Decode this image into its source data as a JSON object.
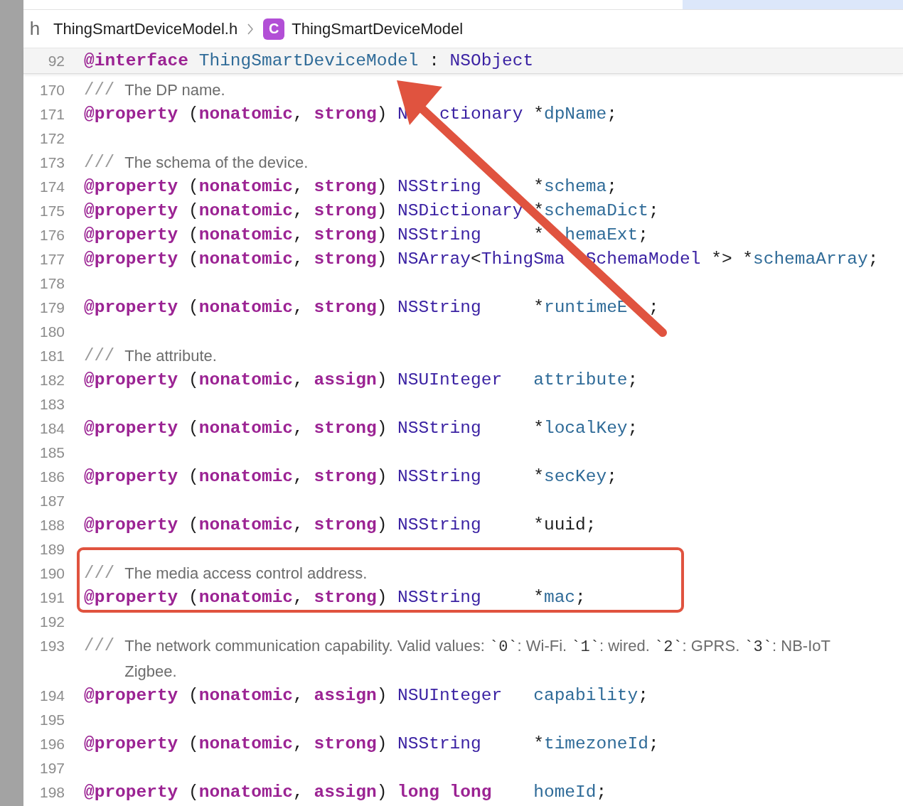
{
  "breadcrumb": {
    "file_icon": "h",
    "file": "ThingSmartDeviceModel.h",
    "class_badge": "C",
    "symbol": "ThingSmartDeviceModel"
  },
  "sticky_header": {
    "number": "92",
    "tokens": [
      {
        "kind": "keyword",
        "text": "@interface "
      },
      {
        "kind": "ident",
        "text": "ThingSmartDeviceModel"
      },
      {
        "kind": "plain",
        "text": " : "
      },
      {
        "kind": "type",
        "text": "NSObject"
      }
    ]
  },
  "lines": [
    {
      "number": "170",
      "kind": "comment",
      "marker": "///",
      "segments": [
        {
          "kind": "text",
          "text": "The DP name."
        }
      ]
    },
    {
      "number": "171",
      "kind": "code",
      "tokens": [
        {
          "kind": "keyword",
          "text": "@property"
        },
        {
          "kind": "plain",
          "text": " ("
        },
        {
          "kind": "keyword",
          "text": "nonatomic"
        },
        {
          "kind": "plain",
          "text": ", "
        },
        {
          "kind": "keyword",
          "text": "strong"
        },
        {
          "kind": "plain",
          "text": ") "
        },
        {
          "kind": "type",
          "text": "N   ctionary"
        },
        {
          "kind": "plain",
          "text": " *"
        },
        {
          "kind": "ident",
          "text": "dpName"
        },
        {
          "kind": "plain",
          "text": ";"
        }
      ]
    },
    {
      "number": "172",
      "kind": "blank"
    },
    {
      "number": "173",
      "kind": "comment",
      "marker": "///",
      "segments": [
        {
          "kind": "text",
          "text": "The schema of the device."
        }
      ]
    },
    {
      "number": "174",
      "kind": "code",
      "tokens": [
        {
          "kind": "keyword",
          "text": "@property"
        },
        {
          "kind": "plain",
          "text": " ("
        },
        {
          "kind": "keyword",
          "text": "nonatomic"
        },
        {
          "kind": "plain",
          "text": ", "
        },
        {
          "kind": "keyword",
          "text": "strong"
        },
        {
          "kind": "plain",
          "text": ") "
        },
        {
          "kind": "type",
          "text": "NSString"
        },
        {
          "kind": "plain",
          "text": "     *"
        },
        {
          "kind": "ident",
          "text": "schema"
        },
        {
          "kind": "plain",
          "text": ";"
        }
      ]
    },
    {
      "number": "175",
      "kind": "code",
      "tokens": [
        {
          "kind": "keyword",
          "text": "@property"
        },
        {
          "kind": "plain",
          "text": " ("
        },
        {
          "kind": "keyword",
          "text": "nonatomic"
        },
        {
          "kind": "plain",
          "text": ", "
        },
        {
          "kind": "keyword",
          "text": "strong"
        },
        {
          "kind": "plain",
          "text": ") "
        },
        {
          "kind": "type",
          "text": "NSDictionary"
        },
        {
          "kind": "plain",
          "text": " *"
        },
        {
          "kind": "ident",
          "text": "schemaDict"
        },
        {
          "kind": "plain",
          "text": ";"
        }
      ]
    },
    {
      "number": "176",
      "kind": "code",
      "tokens": [
        {
          "kind": "keyword",
          "text": "@property"
        },
        {
          "kind": "plain",
          "text": " ("
        },
        {
          "kind": "keyword",
          "text": "nonatomic"
        },
        {
          "kind": "plain",
          "text": ", "
        },
        {
          "kind": "keyword",
          "text": "strong"
        },
        {
          "kind": "plain",
          "text": ") "
        },
        {
          "kind": "type",
          "text": "NSString"
        },
        {
          "kind": "plain",
          "text": "     *"
        },
        {
          "kind": "ident",
          "text": "  hemaExt"
        },
        {
          "kind": "plain",
          "text": ";"
        }
      ]
    },
    {
      "number": "177",
      "kind": "code",
      "tokens": [
        {
          "kind": "keyword",
          "text": "@property"
        },
        {
          "kind": "plain",
          "text": " ("
        },
        {
          "kind": "keyword",
          "text": "nonatomic"
        },
        {
          "kind": "plain",
          "text": ", "
        },
        {
          "kind": "keyword",
          "text": "strong"
        },
        {
          "kind": "plain",
          "text": ") "
        },
        {
          "kind": "type",
          "text": "NSArray"
        },
        {
          "kind": "plain",
          "text": "<"
        },
        {
          "kind": "type",
          "text": "ThingSma  SchemaModel"
        },
        {
          "kind": "plain",
          "text": " *> *"
        },
        {
          "kind": "ident",
          "text": "schemaArray"
        },
        {
          "kind": "plain",
          "text": ";"
        }
      ]
    },
    {
      "number": "178",
      "kind": "blank"
    },
    {
      "number": "179",
      "kind": "code",
      "tokens": [
        {
          "kind": "keyword",
          "text": "@property"
        },
        {
          "kind": "plain",
          "text": " ("
        },
        {
          "kind": "keyword",
          "text": "nonatomic"
        },
        {
          "kind": "plain",
          "text": ", "
        },
        {
          "kind": "keyword",
          "text": "strong"
        },
        {
          "kind": "plain",
          "text": ") "
        },
        {
          "kind": "type",
          "text": "NSString"
        },
        {
          "kind": "plain",
          "text": "     *"
        },
        {
          "kind": "ident",
          "text": "runtimeE  "
        },
        {
          "kind": "plain",
          "text": ";"
        }
      ]
    },
    {
      "number": "180",
      "kind": "blank"
    },
    {
      "number": "181",
      "kind": "comment",
      "marker": "///",
      "segments": [
        {
          "kind": "text",
          "text": "The attribute."
        }
      ]
    },
    {
      "number": "182",
      "kind": "code",
      "tokens": [
        {
          "kind": "keyword",
          "text": "@property"
        },
        {
          "kind": "plain",
          "text": " ("
        },
        {
          "kind": "keyword",
          "text": "nonatomic"
        },
        {
          "kind": "plain",
          "text": ", "
        },
        {
          "kind": "keyword",
          "text": "assign"
        },
        {
          "kind": "plain",
          "text": ") "
        },
        {
          "kind": "type",
          "text": "NSUInteger   "
        },
        {
          "kind": "ident",
          "text": "attribute"
        },
        {
          "kind": "plain",
          "text": ";"
        }
      ]
    },
    {
      "number": "183",
      "kind": "blank"
    },
    {
      "number": "184",
      "kind": "code",
      "tokens": [
        {
          "kind": "keyword",
          "text": "@property"
        },
        {
          "kind": "plain",
          "text": " ("
        },
        {
          "kind": "keyword",
          "text": "nonatomic"
        },
        {
          "kind": "plain",
          "text": ", "
        },
        {
          "kind": "keyword",
          "text": "strong"
        },
        {
          "kind": "plain",
          "text": ") "
        },
        {
          "kind": "type",
          "text": "NSString"
        },
        {
          "kind": "plain",
          "text": "     *"
        },
        {
          "kind": "ident",
          "text": "localKey"
        },
        {
          "kind": "plain",
          "text": ";"
        }
      ]
    },
    {
      "number": "185",
      "kind": "blank"
    },
    {
      "number": "186",
      "kind": "code",
      "tokens": [
        {
          "kind": "keyword",
          "text": "@property"
        },
        {
          "kind": "plain",
          "text": " ("
        },
        {
          "kind": "keyword",
          "text": "nonatomic"
        },
        {
          "kind": "plain",
          "text": ", "
        },
        {
          "kind": "keyword",
          "text": "strong"
        },
        {
          "kind": "plain",
          "text": ") "
        },
        {
          "kind": "type",
          "text": "NSString"
        },
        {
          "kind": "plain",
          "text": "     *"
        },
        {
          "kind": "ident",
          "text": "secKey"
        },
        {
          "kind": "plain",
          "text": ";"
        }
      ]
    },
    {
      "number": "187",
      "kind": "blank"
    },
    {
      "number": "188",
      "kind": "code",
      "tokens": [
        {
          "kind": "keyword",
          "text": "@property"
        },
        {
          "kind": "plain",
          "text": " ("
        },
        {
          "kind": "keyword",
          "text": "nonatomic"
        },
        {
          "kind": "plain",
          "text": ", "
        },
        {
          "kind": "keyword",
          "text": "strong"
        },
        {
          "kind": "plain",
          "text": ") "
        },
        {
          "kind": "type",
          "text": "NSString"
        },
        {
          "kind": "plain",
          "text": "     *uuid;"
        }
      ]
    },
    {
      "number": "189",
      "kind": "blank"
    },
    {
      "number": "190",
      "kind": "comment",
      "marker": "///",
      "segments": [
        {
          "kind": "text",
          "text": "The media access control address."
        }
      ]
    },
    {
      "number": "191",
      "kind": "code",
      "tokens": [
        {
          "kind": "keyword",
          "text": "@property"
        },
        {
          "kind": "plain",
          "text": " ("
        },
        {
          "kind": "keyword",
          "text": "nonatomic"
        },
        {
          "kind": "plain",
          "text": ", "
        },
        {
          "kind": "keyword",
          "text": "strong"
        },
        {
          "kind": "plain",
          "text": ") "
        },
        {
          "kind": "type",
          "text": "NSString"
        },
        {
          "kind": "plain",
          "text": "     *"
        },
        {
          "kind": "ident",
          "text": "mac"
        },
        {
          "kind": "plain",
          "text": ";"
        }
      ]
    },
    {
      "number": "192",
      "kind": "blank"
    },
    {
      "number": "193",
      "kind": "comment",
      "marker": "///",
      "segments": [
        {
          "kind": "text",
          "text": "The network communication capability. Valid values: "
        },
        {
          "kind": "code",
          "text": "`0`"
        },
        {
          "kind": "text",
          "text": ": Wi-Fi. "
        },
        {
          "kind": "code",
          "text": "`1`"
        },
        {
          "kind": "text",
          "text": ": wired. "
        },
        {
          "kind": "code",
          "text": "`2`"
        },
        {
          "kind": "text",
          "text": ": GPRS. "
        },
        {
          "kind": "code",
          "text": "`3`"
        },
        {
          "kind": "text",
          "text": ": NB-IoT"
        }
      ],
      "continuation": "Zigbee."
    },
    {
      "number": "194",
      "kind": "code",
      "tokens": [
        {
          "kind": "keyword",
          "text": "@property"
        },
        {
          "kind": "plain",
          "text": " ("
        },
        {
          "kind": "keyword",
          "text": "nonatomic"
        },
        {
          "kind": "plain",
          "text": ", "
        },
        {
          "kind": "keyword",
          "text": "assign"
        },
        {
          "kind": "plain",
          "text": ") "
        },
        {
          "kind": "type",
          "text": "NSUInteger   "
        },
        {
          "kind": "ident",
          "text": "capability"
        },
        {
          "kind": "plain",
          "text": ";"
        }
      ]
    },
    {
      "number": "195",
      "kind": "blank"
    },
    {
      "number": "196",
      "kind": "code",
      "tokens": [
        {
          "kind": "keyword",
          "text": "@property"
        },
        {
          "kind": "plain",
          "text": " ("
        },
        {
          "kind": "keyword",
          "text": "nonatomic"
        },
        {
          "kind": "plain",
          "text": ", "
        },
        {
          "kind": "keyword",
          "text": "strong"
        },
        {
          "kind": "plain",
          "text": ") "
        },
        {
          "kind": "type",
          "text": "NSString"
        },
        {
          "kind": "plain",
          "text": "     *"
        },
        {
          "kind": "ident",
          "text": "timezoneId"
        },
        {
          "kind": "plain",
          "text": ";"
        }
      ]
    },
    {
      "number": "197",
      "kind": "blank"
    },
    {
      "number": "198",
      "kind": "code",
      "tokens": [
        {
          "kind": "keyword",
          "text": "@property"
        },
        {
          "kind": "plain",
          "text": " ("
        },
        {
          "kind": "keyword",
          "text": "nonatomic"
        },
        {
          "kind": "plain",
          "text": ", "
        },
        {
          "kind": "keyword",
          "text": "assign"
        },
        {
          "kind": "plain",
          "text": ") "
        },
        {
          "kind": "keyword",
          "text": "long long    "
        },
        {
          "kind": "ident",
          "text": "homeId"
        },
        {
          "kind": "plain",
          "text": ";"
        }
      ]
    }
  ]
}
